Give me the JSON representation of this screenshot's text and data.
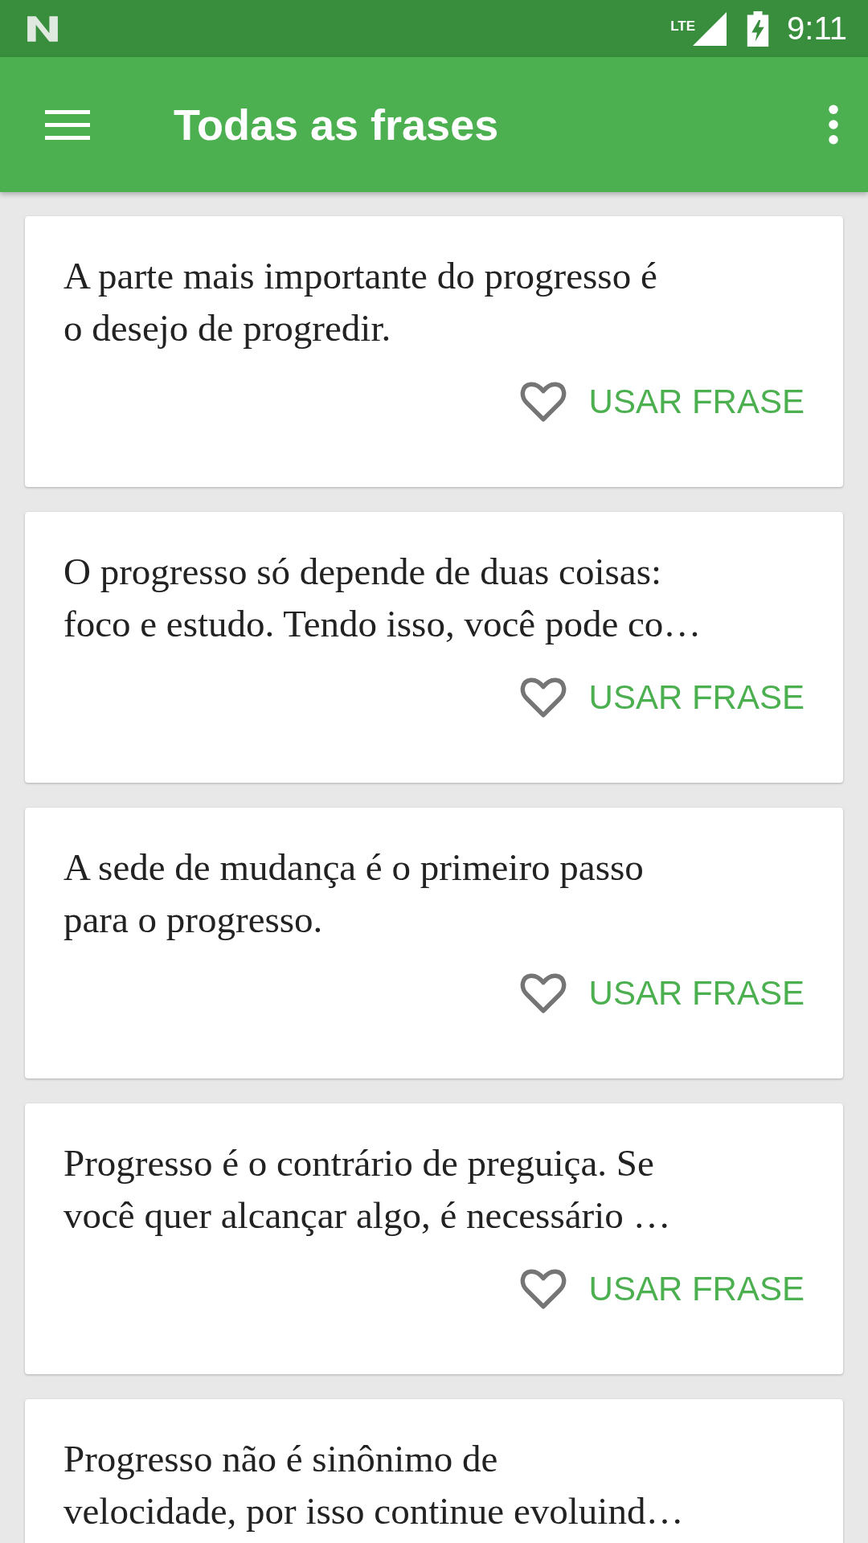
{
  "status_bar": {
    "lte_label": "LTE",
    "time": "9:11"
  },
  "app_bar": {
    "title": "Todas as frases"
  },
  "cards": [
    {
      "lines": [
        "A parte mais importante do progresso é",
        "o desejo de progredir."
      ],
      "favorite": false,
      "action": "USAR FRASE"
    },
    {
      "lines": [
        "O progresso só depende de duas coisas:",
        "foco e estudo. Tendo isso, você pode co…"
      ],
      "favorite": false,
      "action": "USAR FRASE"
    },
    {
      "lines": [
        "A sede de mudança é o primeiro passo",
        "para o progresso."
      ],
      "favorite": false,
      "action": "USAR FRASE"
    },
    {
      "lines": [
        "Progresso é o contrário de preguiça. Se",
        "você quer alcançar algo, é necessário …"
      ],
      "favorite": false,
      "action": "USAR FRASE"
    },
    {
      "lines": [
        "Progresso não é sinônimo de",
        "velocidade, por isso continue evoluind…"
      ]
    }
  ]
}
